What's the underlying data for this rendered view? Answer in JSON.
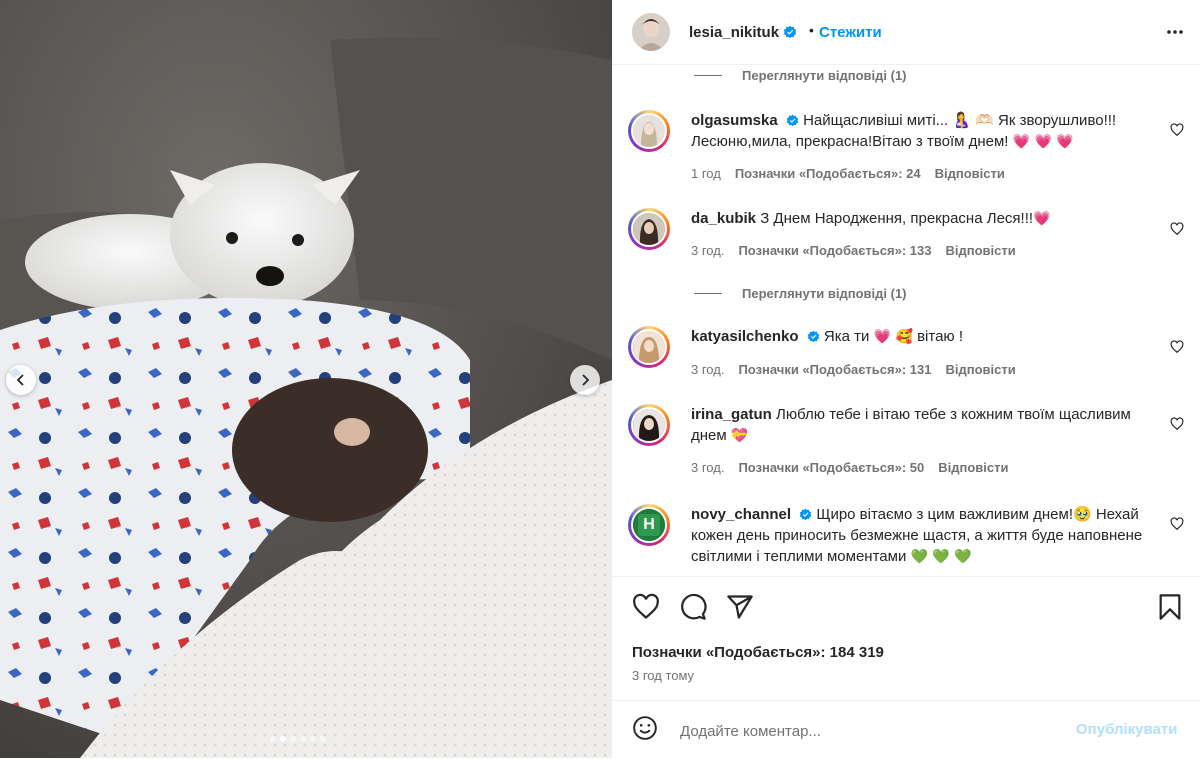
{
  "header": {
    "username": "lesia_nikituk",
    "separator": "•",
    "follow_label": "Стежити"
  },
  "comments": [
    {
      "username": "olgasumska",
      "verified": true,
      "text": "Найщасливіші миті... 🤱 🫶🏻 Як зворушливо!!! Лесюню,мила, прекрасна!Вітаю з твоїм днем!",
      "emojis": "💗 💗 💗",
      "time": "1 год",
      "likes": "Позначки «Подобається»: 24",
      "reply": "Відповісти"
    },
    {
      "username": "da_kubik",
      "verified": false,
      "text": "З Днем Народження, прекрасна Леся!!!",
      "emojis": "💗",
      "time": "3 год.",
      "likes": "Позначки «Подобається»: 133",
      "reply": "Відповісти",
      "view_replies": "Переглянути відповіді (1)"
    },
    {
      "username": "katyasilchenko",
      "verified": true,
      "text": "Яка ти",
      "emojis": "💗 🥰",
      "text_after": "вітаю !",
      "time": "3 год.",
      "likes": "Позначки «Подобається»: 131",
      "reply": "Відповісти"
    },
    {
      "username": "irina_gatun",
      "verified": false,
      "text": "Люблю тебе і вітаю тебе з кожним твоїм щасливим днем",
      "emojis": "💝",
      "time": "3 год.",
      "likes": "Позначки «Подобається»: 50",
      "reply": "Відповісти"
    },
    {
      "username": "novy_channel",
      "verified": true,
      "text": "Щиро вітаємо з цим важливим днем!🥹 Нехай кожен день приносить безмежне щастя, а життя буде наповнене світлими і теплими моментами",
      "emojis": "💚 💚 💚",
      "avatar_letter": "Н"
    }
  ],
  "view_replies_top": "Переглянути відповіді (1)",
  "post": {
    "likes_total": "Позначки «Подобається»: 184 319",
    "time_ago": "3 год тому"
  },
  "composer": {
    "placeholder": "Додайте коментар...",
    "post_label": "Опублікувати"
  },
  "carousel": {
    "slide_count": 6,
    "active_index": 1
  },
  "colors": {
    "link_blue": "#0095f6",
    "verified_blue": "#0095f6",
    "post_disabled": "#b2dffc",
    "muted_text": "#737373",
    "heart_pink": "#ed4956",
    "heart_green": "#2db35d"
  },
  "icons": [
    "verified-badge-icon",
    "more-options-icon",
    "heart-icon",
    "comment-icon",
    "share-icon",
    "bookmark-icon",
    "emoji-icon",
    "chevron-left-icon",
    "chevron-right-icon"
  ]
}
